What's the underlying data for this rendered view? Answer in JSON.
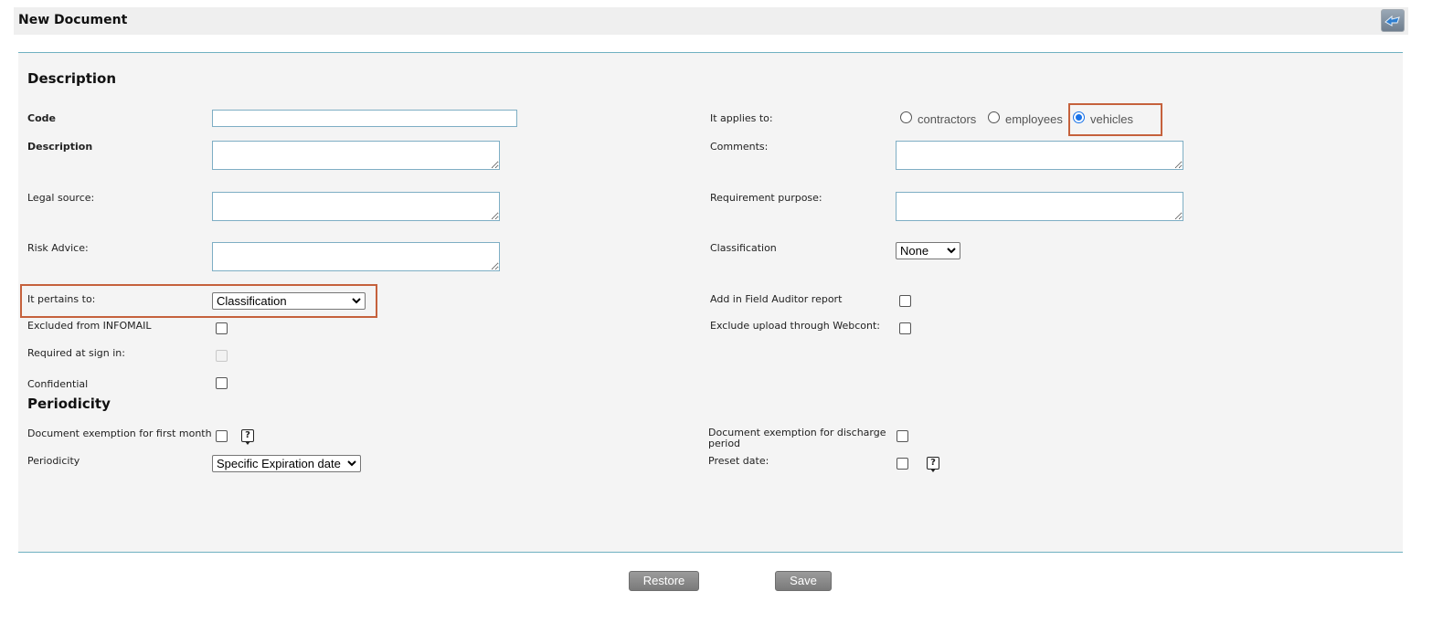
{
  "header": {
    "title": "New Document",
    "back_icon": "back-arrow-icon"
  },
  "description_section": {
    "title": "Description",
    "code_label": "Code",
    "code_value": "",
    "description_label": "Description",
    "legal_source_label": "Legal source:",
    "risk_advice_label": "Risk Advice:",
    "pertains_label": "It pertains to:",
    "pertains_value": "Classification",
    "excluded_infomail_label": "Excluded from INFOMAIL",
    "required_signin_label": "Required at sign in:",
    "confidential_label": "Confidential",
    "applies_label": "It applies to:",
    "applies_options": [
      "contractors",
      "employees",
      "vehicles"
    ],
    "applies_selected": "vehicles",
    "comments_label": "Comments:",
    "requirement_purpose_label": "Requirement purpose:",
    "classification_label": "Classification",
    "classification_value": "None",
    "field_auditor_label": "Add in Field Auditor report",
    "exclude_webcont_label": "Exclude upload through Webcont:"
  },
  "periodicity_section": {
    "title": "Periodicity",
    "exemption_first_month_label": "Document exemption for first month",
    "periodicity_label": "Periodicity",
    "periodicity_value": "Specific Expiration date",
    "exemption_discharge_label": "Document exemption for discharge period",
    "preset_date_label": "Preset date:",
    "help_icon": "question-mark-icon"
  },
  "actions": {
    "restore_label": "Restore",
    "save_label": "Save"
  },
  "colors": {
    "highlight": "#c5613c",
    "panel_border": "#6fb1c1",
    "radio_checked": "#1a73e8"
  }
}
